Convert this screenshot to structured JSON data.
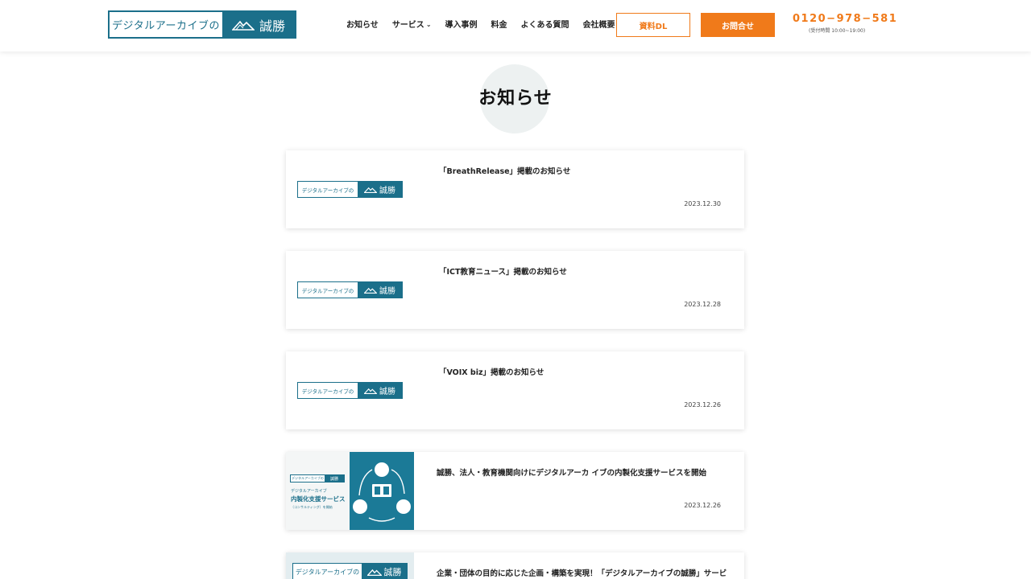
{
  "header": {
    "logo_text_left": "デジタルアーカイブの",
    "logo_text_right": "誠勝",
    "nav": [
      {
        "label": "お知らせ"
      },
      {
        "label": "サービス",
        "has_dropdown": true
      },
      {
        "label": "導入事例"
      },
      {
        "label": "料金"
      },
      {
        "label": "よくある質問"
      },
      {
        "label": "会社概要"
      }
    ],
    "download_button": "資料DL",
    "contact_button": "お問合せ",
    "phone": "0120−978−581",
    "hours": "(受付時間 10:00~19:00)"
  },
  "page_title": "お知らせ",
  "news": [
    {
      "title": "「BreathRelease」掲載のお知らせ",
      "date": "2023.12.30",
      "thumb_logo_left": "デジタルアーカイブの",
      "thumb_logo_right": "誠勝"
    },
    {
      "title": "「ICT教育ニュース」掲載のお知らせ",
      "date": "2023.12.28",
      "thumb_logo_left": "デジタルアーカイブの",
      "thumb_logo_right": "誠勝"
    },
    {
      "title": "「VOIX biz」掲載のお知らせ",
      "date": "2023.12.26",
      "thumb_logo_left": "デジタルアーカイブの",
      "thumb_logo_right": "誠勝"
    },
    {
      "title": "誠勝、法人・教育機関向けにデジタルアーカ イブの内製化支援サービスを開始",
      "date": "2023.12.26",
      "thumb": {
        "logo_left": "デジタルアーカイブの",
        "logo_right": "誠勝",
        "line1": "デジタルアーカイブ",
        "line2": "内製化支援サービス",
        "line3": "（コンサルティング）を開始"
      }
    },
    {
      "title": "企業・団体の目的に応じた企画・構築を実現！「デジタルアーカイブの誠勝」サービ",
      "date": "",
      "thumb_logo_left": "デジタルアーカイブの",
      "thumb_logo_right": "誠勝"
    }
  ],
  "colors": {
    "brand": "#1b6f8a",
    "accent": "#f07a1a"
  }
}
